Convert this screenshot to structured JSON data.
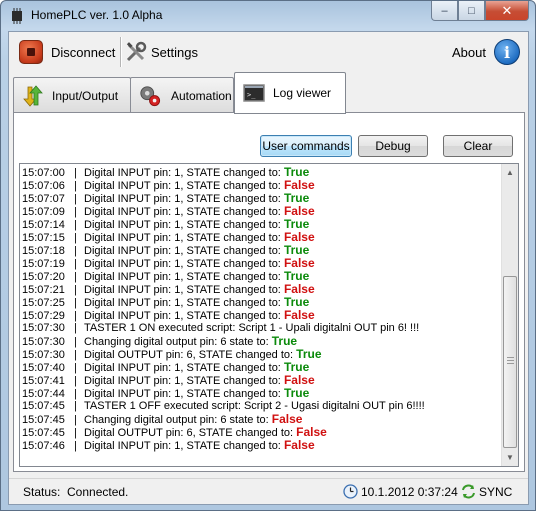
{
  "window": {
    "title": "HomePLC ver. 1.0 Alpha",
    "caption_min": "–",
    "caption_max": "□",
    "caption_close": "✕"
  },
  "toolbar": {
    "disconnect_label": "Disconnect",
    "disconnect_icon": "stop-icon",
    "settings_label": "Settings",
    "settings_icon": "tools-icon",
    "about_label": "About",
    "about_icon": "info-icon",
    "about_glyph": "i"
  },
  "tabs": [
    {
      "label": "Input/Output",
      "icon": "io-arrows-icon",
      "active": false
    },
    {
      "label": "Automation",
      "icon": "gears-icon",
      "active": false
    },
    {
      "label": "Log viewer",
      "icon": "console-icon",
      "active": true
    }
  ],
  "log_viewer": {
    "buttons": {
      "user_commands": "User commands",
      "debug": "Debug",
      "clear": "Clear"
    },
    "entries": [
      {
        "time": "15:07:00",
        "message": "Digital INPUT pin: 1, STATE changed to: ",
        "state": "True"
      },
      {
        "time": "15:07:06",
        "message": "Digital INPUT pin: 1, STATE changed to: ",
        "state": "False"
      },
      {
        "time": "15:07:07",
        "message": "Digital INPUT pin: 1, STATE changed to: ",
        "state": "True"
      },
      {
        "time": "15:07:09",
        "message": "Digital INPUT pin: 1, STATE changed to: ",
        "state": "False"
      },
      {
        "time": "15:07:14",
        "message": "Digital INPUT pin: 1, STATE changed to: ",
        "state": "True"
      },
      {
        "time": "15:07:15",
        "message": "Digital INPUT pin: 1, STATE changed to: ",
        "state": "False"
      },
      {
        "time": "15:07:18",
        "message": "Digital INPUT pin: 1, STATE changed to: ",
        "state": "True"
      },
      {
        "time": "15:07:19",
        "message": "Digital INPUT pin: 1, STATE changed to: ",
        "state": "False"
      },
      {
        "time": "15:07:20",
        "message": "Digital INPUT pin: 1, STATE changed to: ",
        "state": "True"
      },
      {
        "time": "15:07:21",
        "message": "Digital INPUT pin: 1, STATE changed to: ",
        "state": "False"
      },
      {
        "time": "15:07:25",
        "message": "Digital INPUT pin: 1, STATE changed to: ",
        "state": "True"
      },
      {
        "time": "15:07:29",
        "message": "Digital INPUT pin: 1, STATE changed to: ",
        "state": "False"
      },
      {
        "time": "15:07:30",
        "message": "TASTER 1 ON executed script: Script 1 - Upali digitalni OUT pin 6! !!!",
        "state": ""
      },
      {
        "time": "15:07:30",
        "message": "Changing digital output pin: 6 state to: ",
        "state": "True"
      },
      {
        "time": "15:07:30",
        "message": "Digital OUTPUT pin: 6, STATE changed to: ",
        "state": "True"
      },
      {
        "time": "15:07:40",
        "message": "Digital INPUT pin: 1, STATE changed to: ",
        "state": "True"
      },
      {
        "time": "15:07:41",
        "message": "Digital INPUT pin: 1, STATE changed to: ",
        "state": "False"
      },
      {
        "time": "15:07:44",
        "message": "Digital INPUT pin: 1, STATE changed to: ",
        "state": "True"
      },
      {
        "time": "15:07:45",
        "message": "TASTER 1 OFF executed script: Script 2 - Ugasi digitalni OUT pin 6!!!!",
        "state": ""
      },
      {
        "time": "15:07:45",
        "message": "Changing digital output pin: 6 state to: ",
        "state": "False"
      },
      {
        "time": "15:07:45",
        "message": "Digital OUTPUT pin: 6, STATE changed to: ",
        "state": "False"
      },
      {
        "time": "15:07:46",
        "message": "Digital INPUT pin: 1, STATE changed to: ",
        "state": "False"
      }
    ],
    "separator": "|",
    "scroll_up_glyph": "▲",
    "scroll_down_glyph": "▼"
  },
  "statusbar": {
    "label": "Status:",
    "value": "Connected.",
    "clock_icon": "clock-icon",
    "datetime": "10.1.2012 0:37:24",
    "sync_icon": "sync-icon",
    "sync_label": "SYNC"
  },
  "colors": {
    "true": "#0b8a0b",
    "false": "#d01010",
    "accent": "#3c7fb1"
  }
}
